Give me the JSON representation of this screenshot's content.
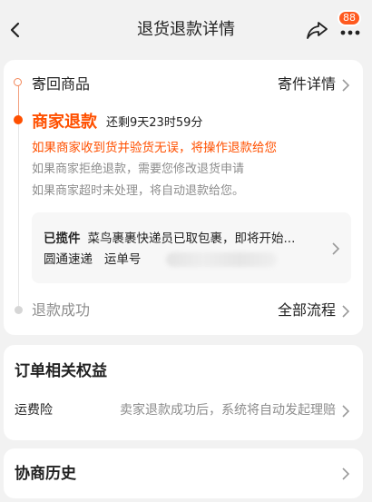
{
  "header": {
    "title": "退货退款详情",
    "notification_count": "88"
  },
  "progress": {
    "step1": {
      "label": "寄回商品",
      "action": "寄件详情"
    },
    "step2": {
      "title": "商家退款",
      "countdown": "还剩9天23时59分",
      "desc_highlight": "如果商家收到货并验货无误，将操作退款给您",
      "desc_reject": "如果商家拒绝退款，需要您修改退货申请",
      "desc_timeout": "如果商家超时未处理，将自动退款给您。"
    },
    "logistics": {
      "status": "已揽件",
      "message": "菜鸟裹裹快递员已取包裹，即将开始...",
      "carrier": "圆通速递",
      "tracking_prefix": "运单号"
    },
    "step3": {
      "label": "退款成功",
      "action": "全部流程"
    }
  },
  "benefits": {
    "title": "订单相关权益",
    "insurance_label": "运费险",
    "insurance_value": "卖家退款成功后，系统将自动发起理赔"
  },
  "history": {
    "title": "协商历史"
  },
  "colors": {
    "accent": "#ff5000",
    "badge": "#ff5a1f",
    "muted": "#8c8c8c"
  }
}
